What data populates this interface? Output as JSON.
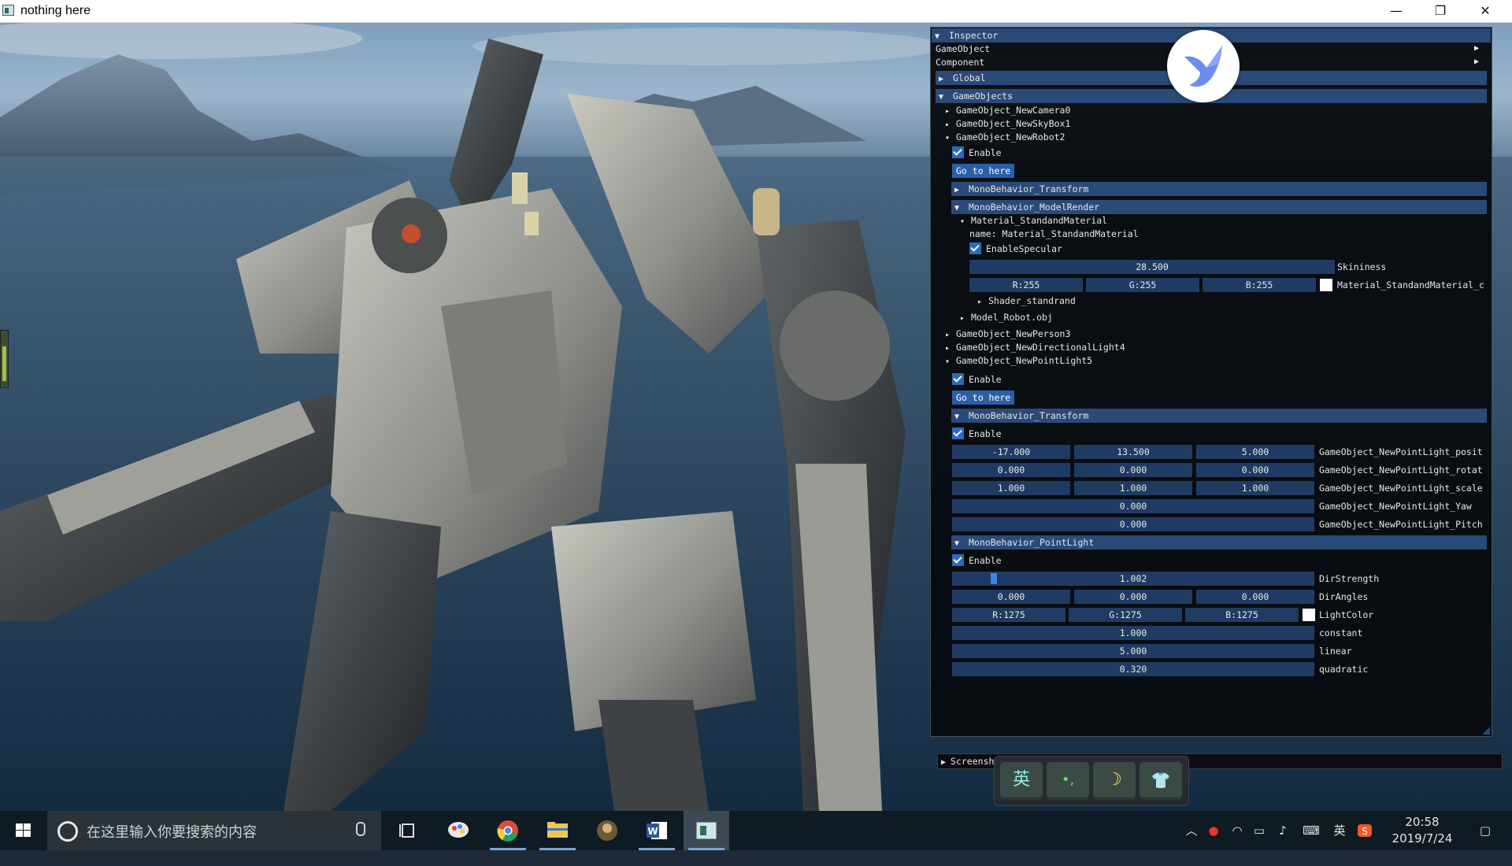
{
  "window": {
    "title": "nothing here",
    "minimize": "—",
    "maximize": "❐",
    "close": "✕"
  },
  "inspector": {
    "title": "Inspector",
    "menu_gameobject": "GameObject",
    "menu_component": "Component",
    "global": "Global",
    "gameobjects": "GameObjects",
    "camera": "GameObject_NewCamera0",
    "skybox": "GameObject_NewSkyBox1",
    "robot": {
      "name": "GameObject_NewRobot2",
      "enable": "Enable",
      "goto": "Go to here",
      "transform": "MonoBehavior_Transform",
      "modelrender": "MonoBehavior_ModelRender",
      "material": "Material_StandandMaterial",
      "material_name": "name: Material_StandandMaterial",
      "enable_specular": "EnableSpecular",
      "skininess_value": "28.500",
      "skininess_label": "Skininess",
      "r": "R:255",
      "g": "G:255",
      "b": "B:255",
      "color_label": "Material_StandandMaterial_c",
      "color_hex": "#ffffff",
      "shader": "Shader_standrand",
      "model": "Model_Robot.obj"
    },
    "person": "GameObject_NewPerson3",
    "dirlight": "GameObject_NewDirectionalLight4",
    "pointlight": {
      "name": "GameObject_NewPointLight5",
      "enable": "Enable",
      "goto": "Go to here",
      "transform": "MonoBehavior_Transform",
      "transform_enable": "Enable",
      "position": [
        "-17.000",
        "13.500",
        "5.000"
      ],
      "position_label": "GameObject_NewPointLight_posit",
      "rotation": [
        "0.000",
        "0.000",
        "0.000"
      ],
      "rotation_label": "GameObject_NewPointLight_rotat",
      "scale": [
        "1.000",
        "1.000",
        "1.000"
      ],
      "scale_label": "GameObject_NewPointLight_scale",
      "yaw": "0.000",
      "yaw_label": "GameObject_NewPointLight_Yaw",
      "pitch": "0.000",
      "pitch_label": "GameObject_NewPointLight_Pitch",
      "light": "MonoBehavior_PointLight",
      "light_enable": "Enable",
      "dirstrength": "1.002",
      "dirstrength_label": "DirStrength",
      "dirangles": [
        "0.000",
        "0.000",
        "0.000"
      ],
      "dirangles_label": "DirAngles",
      "r": "R:1275",
      "g": "G:1275",
      "b": "B:1275",
      "lightcolor_label": "LightColor",
      "lightcolor_hex": "#ffffff",
      "constant": "1.000",
      "constant_label": "constant",
      "linear": "5.000",
      "linear_label": "linear",
      "quadratic": "0.320",
      "quadratic_label": "quadratic"
    }
  },
  "screens_bar": "Screensh",
  "ime": {
    "lang": "英",
    "punct": "•,",
    "moon": "☽",
    "skin": "👕"
  },
  "taskbar": {
    "search_placeholder": "在这里输入你要搜索的内容",
    "ime_indicator": "英",
    "time": "20:58",
    "date": "2019/7/24"
  },
  "colors": {
    "header": "#2a4a78",
    "field": "#203b63",
    "button": "#2a5fa8",
    "check": "#2a6bbd"
  }
}
